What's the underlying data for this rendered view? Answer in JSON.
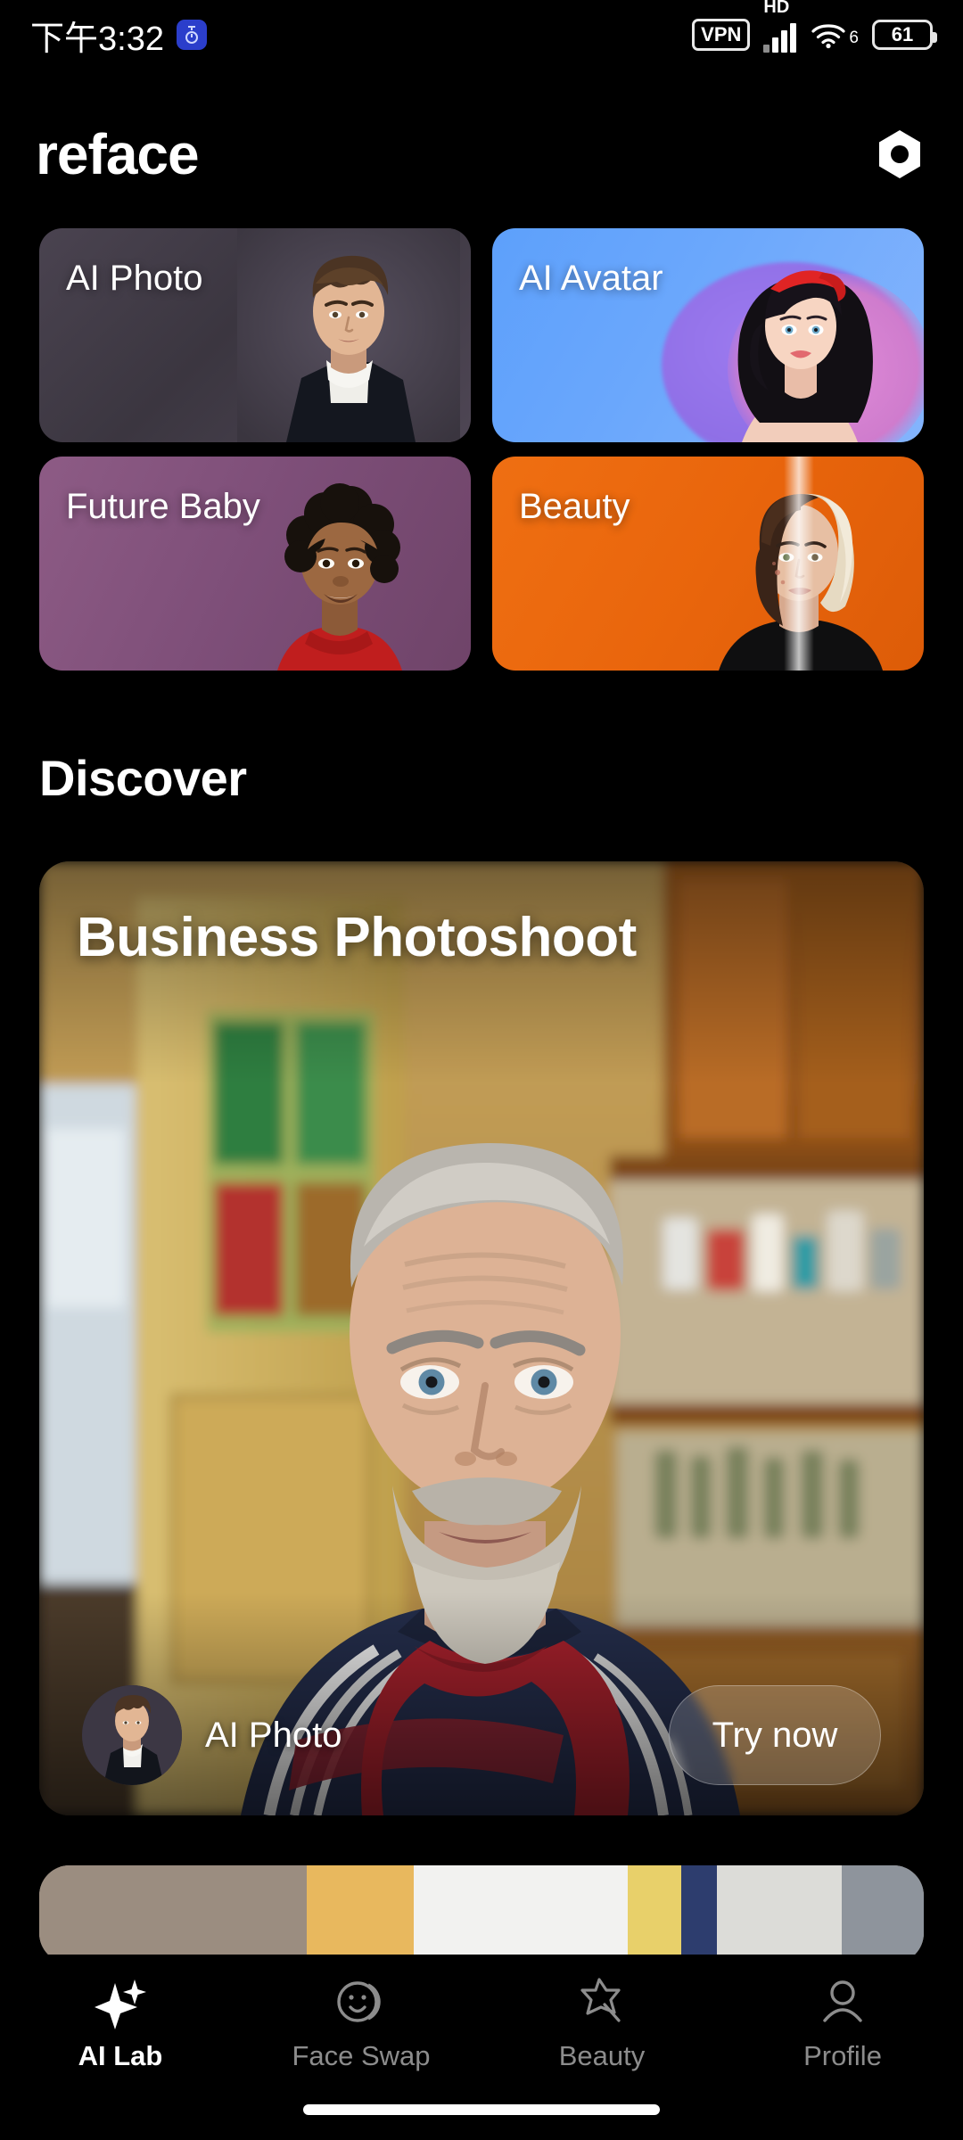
{
  "status_bar": {
    "time": "下午3:32",
    "app_icon": "stopwatch-icon",
    "vpn_label": "VPN",
    "hd_label": "HD",
    "signal_icon": "signal-bars-icon",
    "wifi_icon": "wifi-icon",
    "wifi_generation": "6",
    "battery_level": "61"
  },
  "header": {
    "brand": "reface",
    "settings_icon": "hexagon-nut-icon"
  },
  "features": [
    {
      "label": "AI Photo",
      "art": "young-man-portrait",
      "bg": "#453f4b"
    },
    {
      "label": "AI Avatar",
      "art": "cartoon-woman-avatar",
      "bg": "#6aa7fc"
    },
    {
      "label": "Future Baby",
      "art": "smiling-child",
      "bg": "#7d4e78"
    },
    {
      "label": "Beauty",
      "art": "split-face-beauty",
      "bg": "#e9650c"
    }
  ],
  "discover": {
    "section_title": "Discover",
    "cards": [
      {
        "title": "Business Photoshoot",
        "avatar_label": "AI Photo",
        "cta_label": "Try now",
        "art": "older-man-kitchen-portrait"
      }
    ]
  },
  "bottom_nav": {
    "items": [
      {
        "label": "AI Lab",
        "icon": "sparkle-icon",
        "active": true
      },
      {
        "label": "Face Swap",
        "icon": "face-swap-icon",
        "active": false
      },
      {
        "label": "Beauty",
        "icon": "magic-wand-icon",
        "active": false
      },
      {
        "label": "Profile",
        "icon": "person-icon",
        "active": false
      }
    ]
  },
  "colors": {
    "background": "#000000",
    "active_nav": "#ffffff",
    "inactive_nav": "#8c8c8c"
  }
}
